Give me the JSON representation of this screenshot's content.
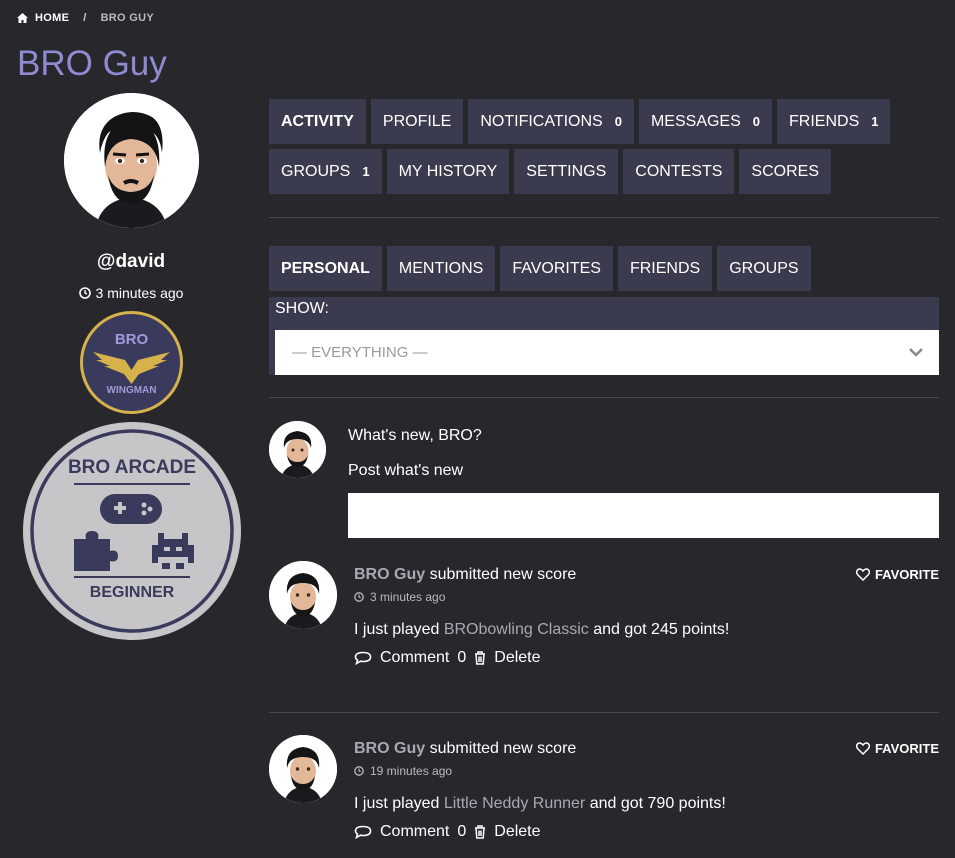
{
  "breadcrumb": {
    "home": "HOME",
    "separator": "/",
    "current": "BRO GUY"
  },
  "profile": {
    "title": "BRO Guy",
    "username": "@david",
    "last_active": "3 minutes ago",
    "badges": {
      "wingman": {
        "top": "BRO",
        "bottom": "WINGMAN"
      },
      "arcade": {
        "top": "BRO ARCADE",
        "bottom": "BEGINNER"
      }
    }
  },
  "main_tabs": {
    "activity": "ACTIVITY",
    "profile": "PROFILE",
    "notifications": {
      "label": "NOTIFICATIONS",
      "count": "0"
    },
    "messages": {
      "label": "MESSAGES",
      "count": "0"
    },
    "friends": {
      "label": "FRIENDS",
      "count": "1"
    },
    "groups": {
      "label": "GROUPS",
      "count": "1"
    },
    "my_history": "MY HISTORY",
    "settings": "SETTINGS",
    "contests": "CONTESTS",
    "scores": "SCORES"
  },
  "sub_tabs": {
    "personal": "PERSONAL",
    "mentions": "MENTIONS",
    "favorites": "FAVORITES",
    "friends": "FRIENDS",
    "groups": "GROUPS"
  },
  "filter": {
    "label": "SHOW:",
    "selected": "— EVERYTHING —"
  },
  "post_form": {
    "prompt": "What's new, BRO?",
    "label": "Post what's new",
    "placeholder": ""
  },
  "activities": [
    {
      "user": "BRO Guy",
      "action": " submitted new score",
      "time": "3 minutes ago",
      "text_before": "I just played ",
      "game": "BRObowling Classic",
      "text_after": " and got 245 points!",
      "comment_label": "Comment",
      "comment_count": "0",
      "delete_label": "Delete",
      "favorite_label": "FAVORITE"
    },
    {
      "user": "BRO Guy",
      "action": " submitted new score",
      "time": "19 minutes ago",
      "text_before": "I just played ",
      "game": "Little Neddy Runner",
      "text_after": " and got 790 points!",
      "comment_label": "Comment",
      "comment_count": "0",
      "delete_label": "Delete",
      "favorite_label": "FAVORITE"
    }
  ],
  "colors": {
    "background": "#28272c",
    "tab_background": "#3b3b50",
    "title_accent": "#8f8bd3",
    "badge_gold": "#d6b24a",
    "badge_navy": "#3a3a5c"
  },
  "icons": {
    "home": "home-icon",
    "clock": "clock-icon",
    "chevron": "chevron-down-icon",
    "comment": "comment-icon",
    "delete": "trash-icon",
    "favorite": "heart-icon"
  }
}
